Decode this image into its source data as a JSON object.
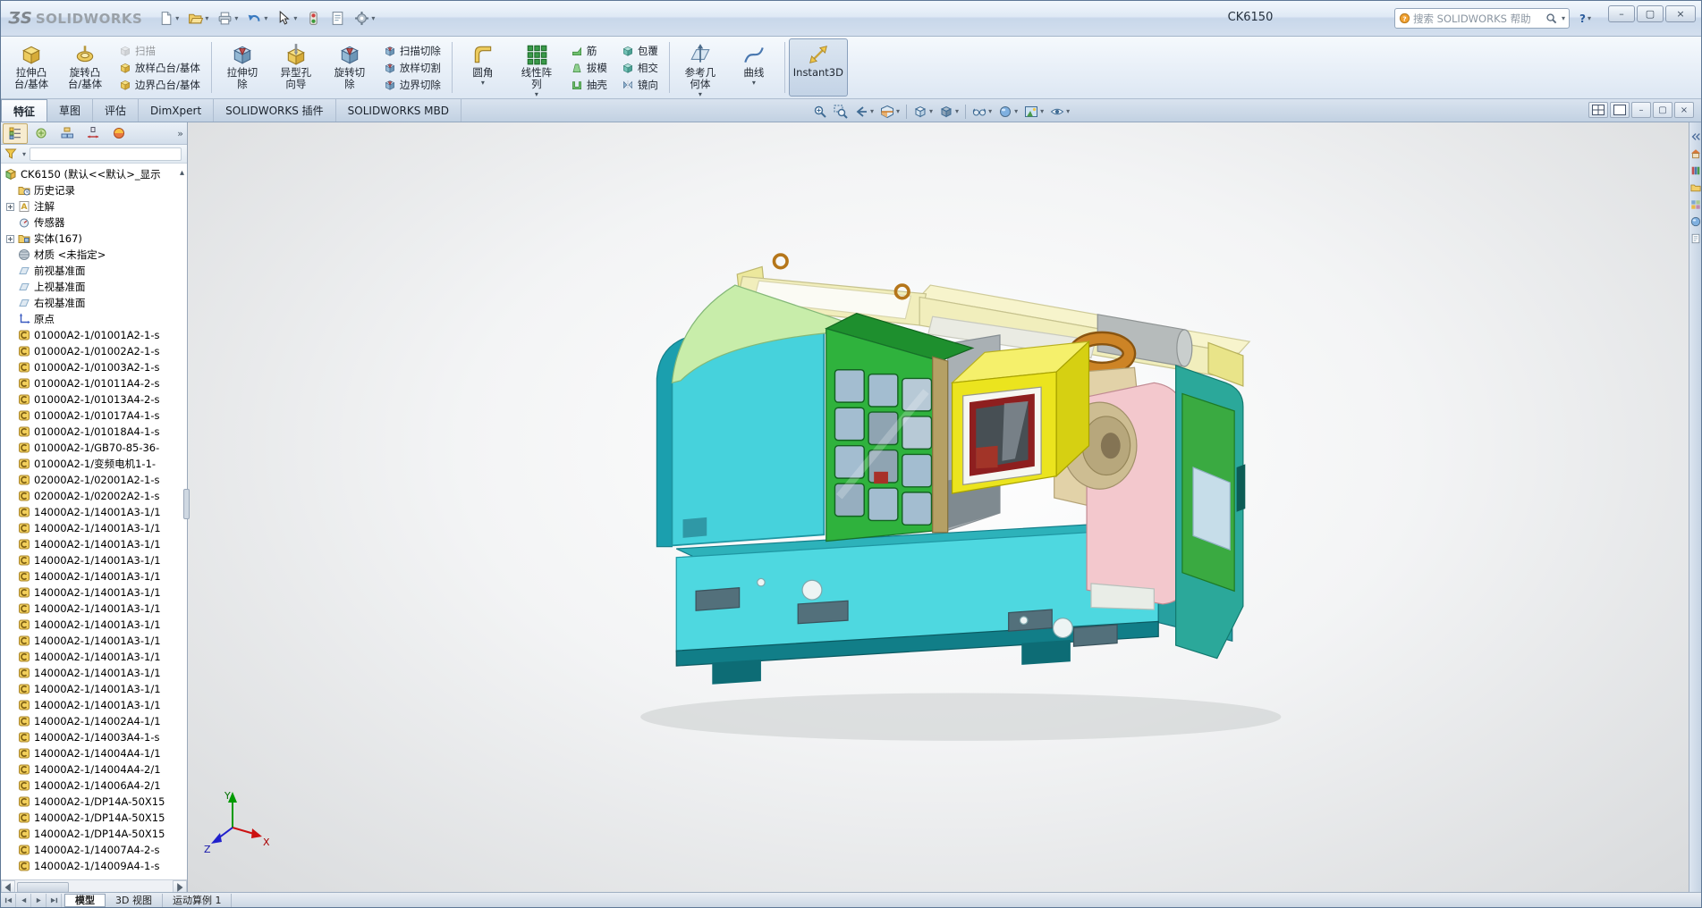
{
  "window": {
    "logo_mark": "ƷS",
    "brand": "SOLIDWORKS",
    "title": "CK6150",
    "search_placeholder": "搜索 SOLIDWORKS 帮助",
    "controls": {
      "minimize": "–",
      "restore": "▢",
      "close": "×",
      "help": "?"
    }
  },
  "quick_toolbar": [
    {
      "name": "new-document",
      "arrow": true
    },
    {
      "name": "open-document",
      "arrow": true
    },
    {
      "name": "print",
      "arrow": true
    },
    {
      "name": "undo",
      "arrow": true
    },
    {
      "name": "select",
      "arrow": true
    },
    {
      "name": "rebuild",
      "arrow": false
    },
    {
      "name": "file-properties",
      "arrow": false
    },
    {
      "name": "options",
      "arrow": true
    }
  ],
  "ribbon": {
    "items": [
      {
        "type": "large",
        "name": "extruded-boss-base",
        "icon": "extruded-boss-icon",
        "lines": [
          "拉伸凸",
          "台/基体"
        ]
      },
      {
        "type": "large",
        "name": "revolved-boss-base",
        "icon": "revolved-boss-icon",
        "lines": [
          "旋转凸",
          "台/基体"
        ]
      },
      {
        "type": "stack",
        "items": [
          {
            "name": "swept-boss",
            "icon": "swept-boss-icon",
            "label": "扫描",
            "disabled": true
          },
          {
            "name": "lofted-boss",
            "icon": "lofted-boss-icon",
            "label": "放样凸台/基体"
          },
          {
            "name": "boundary-boss",
            "icon": "boundary-boss-icon",
            "label": "边界凸台/基体"
          }
        ]
      },
      {
        "type": "sep"
      },
      {
        "type": "large",
        "name": "extruded-cut",
        "icon": "extruded-cut-icon",
        "lines": [
          "拉伸切",
          "除"
        ]
      },
      {
        "type": "large",
        "name": "hole-wizard",
        "icon": "hole-wizard-icon",
        "lines": [
          "异型孔",
          "向导"
        ]
      },
      {
        "type": "large",
        "name": "revolved-cut",
        "icon": "revolved-cut-icon",
        "lines": [
          "旋转切",
          "除"
        ]
      },
      {
        "type": "stack",
        "items": [
          {
            "name": "swept-cut",
            "icon": "swept-cut-icon",
            "label": "扫描切除"
          },
          {
            "name": "lofted-cut",
            "icon": "lofted-cut-icon",
            "label": "放样切割"
          },
          {
            "name": "boundary-cut",
            "icon": "boundary-cut-icon",
            "label": "边界切除"
          }
        ]
      },
      {
        "type": "sep"
      },
      {
        "type": "large",
        "name": "fillet",
        "icon": "fillet-icon",
        "lines": [
          "圆角"
        ],
        "arrow": true
      },
      {
        "type": "large",
        "name": "linear-pattern",
        "icon": "linear-pattern-icon",
        "lines": [
          "线性阵",
          "列"
        ],
        "arrow": true
      },
      {
        "type": "stack",
        "items": [
          {
            "name": "rib",
            "icon": "rib-icon",
            "label": "筋"
          },
          {
            "name": "draft",
            "icon": "draft-icon",
            "label": "拔模"
          },
          {
            "name": "shell",
            "icon": "shell-icon",
            "label": "抽壳"
          }
        ]
      },
      {
        "type": "stack",
        "items": [
          {
            "name": "wrap",
            "icon": "wrap-icon",
            "label": "包覆"
          },
          {
            "name": "intersect",
            "icon": "intersect-icon",
            "label": "相交"
          },
          {
            "name": "mirror",
            "icon": "mirror-icon",
            "label": "镜向"
          }
        ]
      },
      {
        "type": "sep"
      },
      {
        "type": "large",
        "name": "reference-geometry",
        "icon": "reference-geometry-icon",
        "lines": [
          "参考几",
          "何体"
        ],
        "arrow": true
      },
      {
        "type": "large",
        "name": "curves",
        "icon": "curves-icon",
        "lines": [
          "曲线"
        ],
        "arrow": true
      },
      {
        "type": "sep"
      },
      {
        "type": "large",
        "name": "instant3d",
        "icon": "instant3d-icon",
        "lines": [
          "Instant3D"
        ],
        "pressed": true
      }
    ]
  },
  "command_tabs": [
    {
      "label": "特征",
      "active": true
    },
    {
      "label": "草图"
    },
    {
      "label": "评估"
    },
    {
      "label": "DimXpert"
    },
    {
      "label": "SOLIDWORKS 插件"
    },
    {
      "label": "SOLIDWORKS MBD"
    }
  ],
  "headsup": [
    {
      "icon": "zoom-fit-icon"
    },
    {
      "icon": "zoom-area-icon"
    },
    {
      "icon": "previous-view-icon",
      "arrow": true
    },
    {
      "icon": "section-view-icon",
      "arrow": true
    },
    {
      "sep": true
    },
    {
      "icon": "view-orientation-icon",
      "arrow": true
    },
    {
      "icon": "display-style-icon",
      "arrow": true
    },
    {
      "sep": true
    },
    {
      "icon": "hide-show-items-icon",
      "arrow": true
    },
    {
      "icon": "edit-appearance-icon",
      "arrow": true
    },
    {
      "icon": "apply-scene-icon",
      "arrow": true
    },
    {
      "icon": "view-settings-icon",
      "arrow": true
    }
  ],
  "doc_controls": {
    "panes": [
      "four-viewport-icon",
      "single-viewport-icon"
    ],
    "minimize": "–",
    "restore": "▢",
    "close": "×"
  },
  "feature_panel": {
    "manager_tabs": [
      {
        "name": "featuremanager",
        "active": true
      },
      {
        "name": "propertymanager"
      },
      {
        "name": "configurationmanager"
      },
      {
        "name": "dimxpertmanager"
      },
      {
        "name": "displaymanager"
      }
    ],
    "overflow_glyph": "»",
    "collapse_glyph": "▴",
    "filter_icon": "filter-funnel-icon",
    "tree": {
      "root": {
        "label": "CK6150 (默认<<默认>_显示",
        "icon": "assembly-icon"
      },
      "items": [
        {
          "label": "历史记录",
          "icon": "history-folder-icon"
        },
        {
          "label": "注解",
          "icon": "annotations-icon",
          "expandable": true
        },
        {
          "label": "传感器",
          "icon": "sensors-icon"
        },
        {
          "label": "实体(167)",
          "icon": "solid-bodies-icon",
          "expandable": true
        },
        {
          "label": "材质 <未指定>",
          "icon": "material-icon"
        },
        {
          "label": "前视基准面",
          "icon": "plane-icon"
        },
        {
          "label": "上视基准面",
          "icon": "plane-icon"
        },
        {
          "label": "右视基准面",
          "icon": "plane-icon"
        },
        {
          "label": "原点",
          "icon": "origin-icon"
        },
        {
          "label": "01000A2-1/01001A2-1-s",
          "icon": "feature-icon"
        },
        {
          "label": "01000A2-1/01002A2-1-s",
          "icon": "feature-icon"
        },
        {
          "label": "01000A2-1/01003A2-1-s",
          "icon": "feature-icon"
        },
        {
          "label": "01000A2-1/01011A4-2-s",
          "icon": "feature-icon"
        },
        {
          "label": "01000A2-1/01013A4-2-s",
          "icon": "feature-icon"
        },
        {
          "label": "01000A2-1/01017A4-1-s",
          "icon": "feature-icon"
        },
        {
          "label": "01000A2-1/01018A4-1-s",
          "icon": "feature-icon"
        },
        {
          "label": "01000A2-1/GB70-85-36-",
          "icon": "feature-icon"
        },
        {
          "label": "01000A2-1/变频电机1-1-",
          "icon": "feature-icon"
        },
        {
          "label": "02000A2-1/02001A2-1-s",
          "icon": "feature-icon"
        },
        {
          "label": "02000A2-1/02002A2-1-s",
          "icon": "feature-icon"
        },
        {
          "label": "14000A2-1/14001A3-1/1",
          "icon": "feature-icon"
        },
        {
          "label": "14000A2-1/14001A3-1/1",
          "icon": "feature-icon"
        },
        {
          "label": "14000A2-1/14001A3-1/1",
          "icon": "feature-icon"
        },
        {
          "label": "14000A2-1/14001A3-1/1",
          "icon": "feature-icon"
        },
        {
          "label": "14000A2-1/14001A3-1/1",
          "icon": "feature-icon"
        },
        {
          "label": "14000A2-1/14001A3-1/1",
          "icon": "feature-icon"
        },
        {
          "label": "14000A2-1/14001A3-1/1",
          "icon": "feature-icon"
        },
        {
          "label": "14000A2-1/14001A3-1/1",
          "icon": "feature-icon"
        },
        {
          "label": "14000A2-1/14001A3-1/1",
          "icon": "feature-icon"
        },
        {
          "label": "14000A2-1/14001A3-1/1",
          "icon": "feature-icon"
        },
        {
          "label": "14000A2-1/14001A3-1/1",
          "icon": "feature-icon"
        },
        {
          "label": "14000A2-1/14001A3-1/1",
          "icon": "feature-icon"
        },
        {
          "label": "14000A2-1/14001A3-1/1",
          "icon": "feature-icon"
        },
        {
          "label": "14000A2-1/14002A4-1/1",
          "icon": "feature-icon"
        },
        {
          "label": "14000A2-1/14003A4-1-s",
          "icon": "feature-icon"
        },
        {
          "label": "14000A2-1/14004A4-1/1",
          "icon": "feature-icon"
        },
        {
          "label": "14000A2-1/14004A4-2/1",
          "icon": "feature-icon"
        },
        {
          "label": "14000A2-1/14006A4-2/1",
          "icon": "feature-icon"
        },
        {
          "label": "14000A2-1/DP14A-50X15",
          "icon": "feature-icon"
        },
        {
          "label": "14000A2-1/DP14A-50X15",
          "icon": "feature-icon"
        },
        {
          "label": "14000A2-1/DP14A-50X15",
          "icon": "feature-icon"
        },
        {
          "label": "14000A2-1/14007A4-2-s",
          "icon": "feature-icon"
        },
        {
          "label": "14000A2-1/14009A4-1-s",
          "icon": "feature-icon"
        }
      ]
    }
  },
  "viewport": {
    "triad": {
      "x": "X",
      "y": "Y",
      "z": "Z"
    }
  },
  "taskpane_icons": [
    "collapse-panel-icon",
    "resources-icon",
    "design-library-icon",
    "file-explorer-icon",
    "view-palette-icon",
    "appearances-icon",
    "custom-properties-icon"
  ],
  "bottom_bar": {
    "nav": [
      "scroll-first",
      "scroll-prev",
      "scroll-next",
      "scroll-last"
    ],
    "tabs": [
      {
        "label": "模型",
        "active": true
      },
      {
        "label": "3D 视图"
      },
      {
        "label": "运动算例 1"
      }
    ]
  },
  "colors": {
    "machine_cyan": "#46d2dc",
    "machine_light_green": "#c8edaa",
    "machine_green": "#2fb23d",
    "machine_yellow": "#ebe41e",
    "machine_pink": "#f3c8cd",
    "machine_teal_end": "#2ba89a",
    "machine_cream": "#f1eebc",
    "base_dark_teal": "#117e88",
    "ribbon_icon_gold": "#ecc95e",
    "ribbon_icon_blue": "#93b8d4"
  }
}
